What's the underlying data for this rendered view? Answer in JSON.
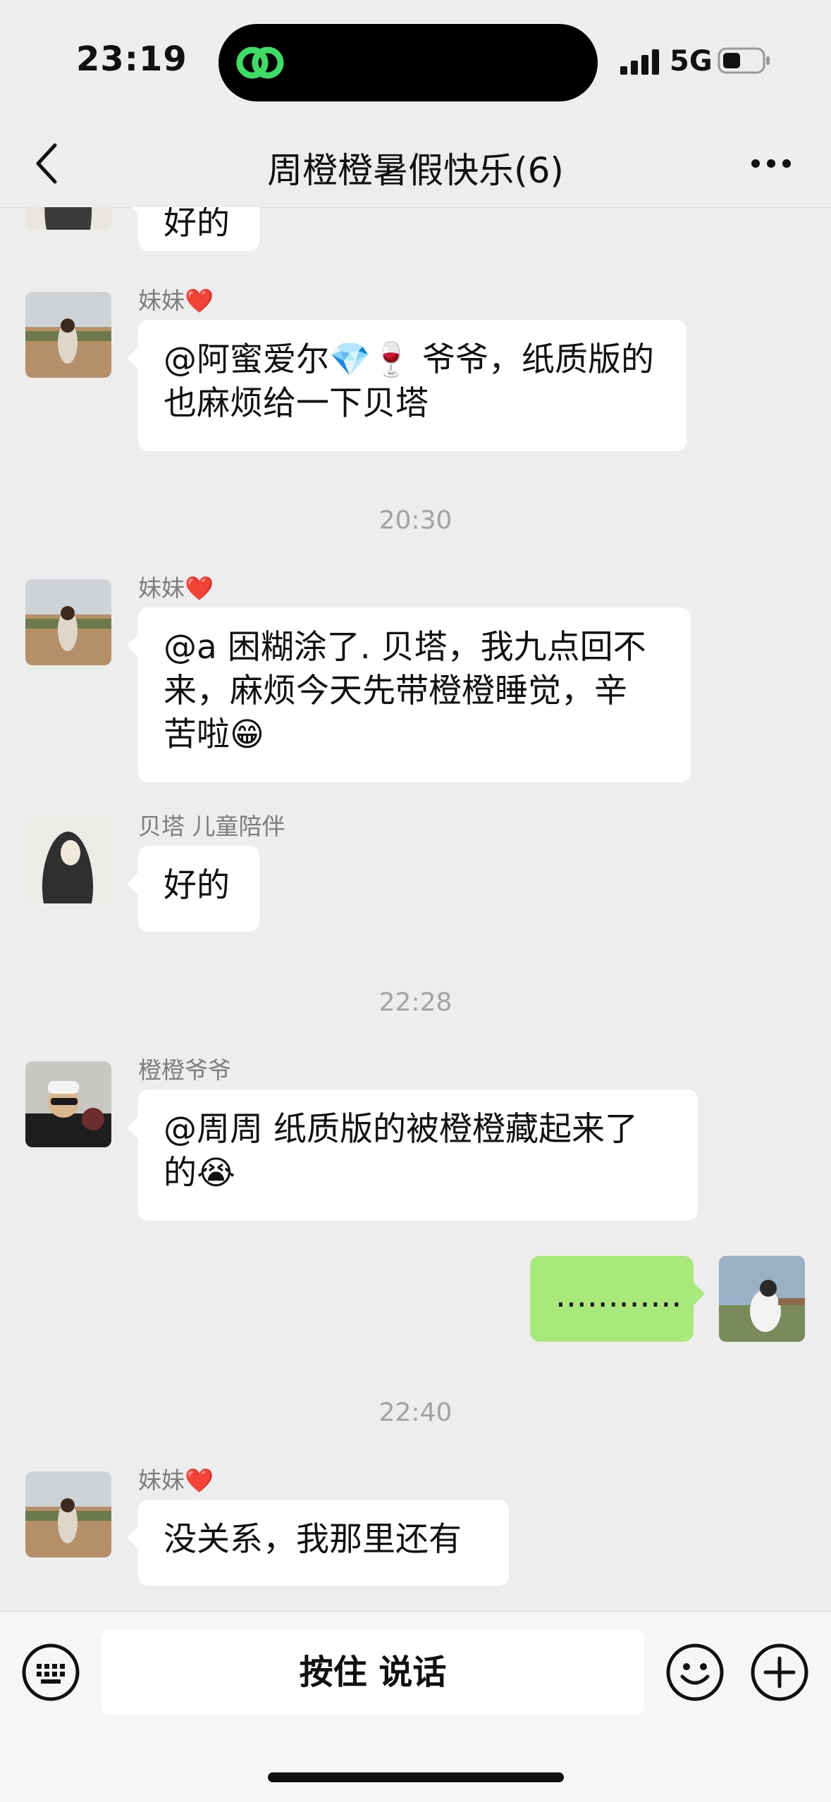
{
  "status": {
    "time": "23:19",
    "network": "5G"
  },
  "nav": {
    "title": "周橙橙暑假快乐(6)"
  },
  "messages": {
    "m0": {
      "text": "好的"
    },
    "m1": {
      "sender": "妹妹",
      "sender_emoji": "❤️",
      "text": "@阿蜜爱尔💎🍷 爷爷，纸质版的也麻烦给一下贝塔"
    },
    "t1": "20:30",
    "m2": {
      "sender": "妹妹",
      "sender_emoji": "❤️",
      "line1": "@a 困糊涂了. 贝塔，我九点回不",
      "line2": "来，麻烦今天先带橙橙睡觉，辛",
      "line3": "苦啦😁"
    },
    "m3": {
      "sender": "贝塔 儿童陪伴",
      "text": "好的"
    },
    "t2": "22:28",
    "m4": {
      "sender": "橙橙爷爷",
      "line1": "@周周 纸质版的被橙橙藏起来了",
      "line2": "的😭"
    },
    "m5": {
      "text": "............"
    },
    "t3": "22:40",
    "m6": {
      "sender": "妹妹",
      "sender_emoji": "❤️",
      "text": "没关系，我那里还有"
    }
  },
  "input": {
    "voice_label": "按住 说话"
  },
  "icons": {
    "keyboard": "keyboard-icon",
    "emoji": "smile-icon",
    "plus": "plus-circle-icon"
  },
  "colors": {
    "self_bubble": "#a9e97b",
    "other_bubble": "#ffffff",
    "background": "#ededed",
    "logo_green": "#3ddc64"
  }
}
